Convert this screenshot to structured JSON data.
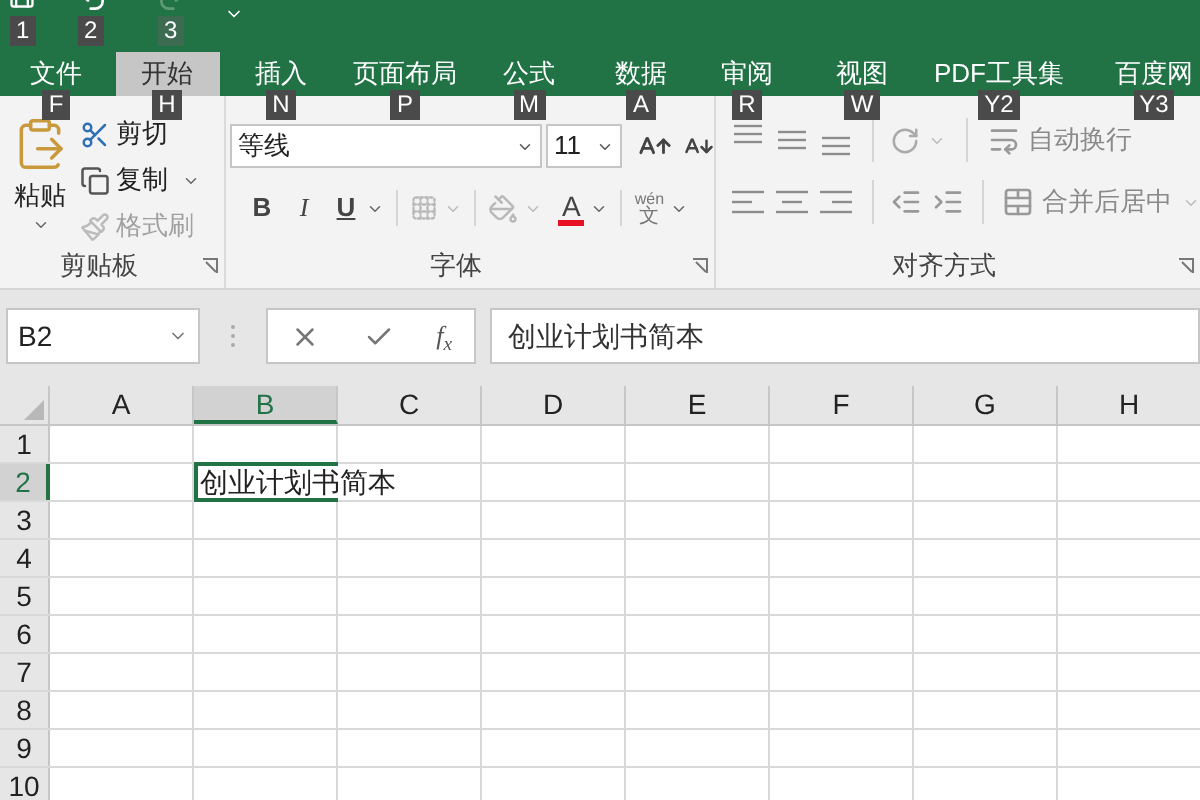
{
  "quick_access": [
    {
      "kind": "save",
      "key_tip": "1",
      "disabled": false
    },
    {
      "kind": "undo",
      "key_tip": "2",
      "disabled": false
    },
    {
      "kind": "redo",
      "key_tip": "3",
      "disabled": true
    }
  ],
  "tabs": [
    {
      "label": "文件",
      "key_tip": "F",
      "selected": false
    },
    {
      "label": "开始",
      "key_tip": "H",
      "selected": true
    },
    {
      "label": "插入",
      "key_tip": "N",
      "selected": false
    },
    {
      "label": "页面布局",
      "key_tip": "P",
      "selected": false
    },
    {
      "label": "公式",
      "key_tip": "M",
      "selected": false
    },
    {
      "label": "数据",
      "key_tip": "A",
      "selected": false
    },
    {
      "label": "审阅",
      "key_tip": "R",
      "selected": false
    },
    {
      "label": "视图",
      "key_tip": "W",
      "selected": false
    },
    {
      "label": "PDF工具集",
      "key_tip": "Y2",
      "selected": false
    },
    {
      "label": "百度网",
      "key_tip": "Y3",
      "selected": false
    }
  ],
  "clipboard": {
    "paste": "粘贴",
    "cut": "剪切",
    "copy": "复制",
    "format_painter": "格式刷",
    "format_painter_disabled": true,
    "label": "剪贴板"
  },
  "font": {
    "name": "等线",
    "size": "11",
    "bold": "B",
    "italic": "I",
    "underline": "U",
    "color_letter": "A",
    "phonetic": "wén",
    "phonetic_char": "文",
    "label": "字体"
  },
  "alignment": {
    "wrap": "自动换行",
    "merge": "合并后居中",
    "disabled": true,
    "label": "对齐方式"
  },
  "name_box": "B2",
  "function_label": "f$_{x}$",
  "formula": "创业计划书简本",
  "columns": [
    {
      "label": "A",
      "selected": false
    },
    {
      "label": "B",
      "selected": true
    },
    {
      "label": "C",
      "selected": false
    },
    {
      "label": "D",
      "selected": false
    },
    {
      "label": "E",
      "selected": false
    },
    {
      "label": "F",
      "selected": false
    },
    {
      "label": "G",
      "selected": false
    },
    {
      "label": "H",
      "selected": false
    }
  ],
  "rows": [
    {
      "label": "1",
      "selected": false
    },
    {
      "label": "2",
      "selected": true,
      "text": "创业计划书简本"
    },
    {
      "label": "3",
      "selected": false
    },
    {
      "label": "4",
      "selected": false
    },
    {
      "label": "5",
      "selected": false
    },
    {
      "label": "6",
      "selected": false
    },
    {
      "label": "7",
      "selected": false
    },
    {
      "label": "8",
      "selected": false
    },
    {
      "label": "9",
      "selected": false
    },
    {
      "label": "10",
      "selected": false
    }
  ]
}
